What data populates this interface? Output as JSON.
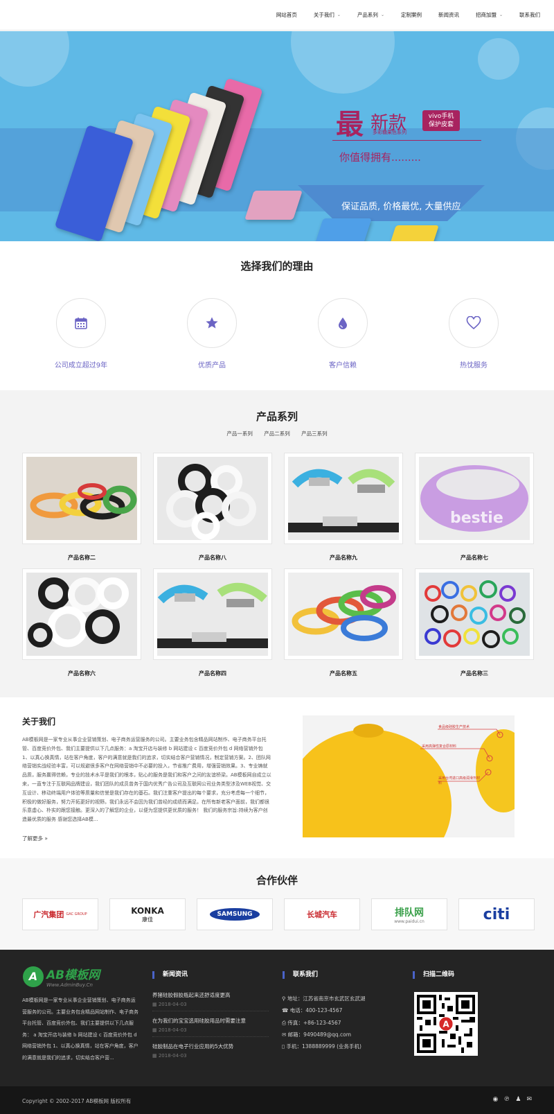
{
  "nav": {
    "items": [
      {
        "label": "网站首页",
        "dropdown": false
      },
      {
        "label": "关于我们",
        "dropdown": true
      },
      {
        "label": "产品系列",
        "dropdown": true
      },
      {
        "label": "定制案例",
        "dropdown": false
      },
      {
        "label": "新闻资讯",
        "dropdown": false
      },
      {
        "label": "招商加盟",
        "dropdown": true
      },
      {
        "label": "联系我们",
        "dropdown": false
      }
    ]
  },
  "banner": {
    "big": "最",
    "new": "新款",
    "tag": "vivo手机 保护皮套",
    "sub": "多彩糖果色系列",
    "want": "你值得拥有.........",
    "guarantee": "保证品质, 价格最优, 大量供应",
    "colors": {
      "sky": "#5fb9e6",
      "magenta": "#a8235f"
    }
  },
  "reasons": {
    "title": "选择我们的理由",
    "items": [
      {
        "label": "公司成立超过9年",
        "icon": "calendar-icon"
      },
      {
        "label": "优质产品",
        "icon": "star-icon"
      },
      {
        "label": "客户信赖",
        "icon": "water-drop-icon"
      },
      {
        "label": "热忱服务",
        "icon": "heart-icon"
      }
    ]
  },
  "products": {
    "title": "产品系列",
    "categories": [
      "产品一系列",
      "产品二系列",
      "产品三系列"
    ],
    "items": [
      {
        "name": "产品名称二"
      },
      {
        "name": "产品名称八"
      },
      {
        "name": "产品名称九"
      },
      {
        "name": "产品名称七"
      },
      {
        "name": "产品名称六"
      },
      {
        "name": "产品名称四"
      },
      {
        "name": "产品名称五"
      },
      {
        "name": "产品名称三"
      }
    ]
  },
  "about": {
    "title": "关于我们",
    "text": "AB模板网是一家专业从事企业营销策划、电子商务运营服务的公司。主要业务包含精品网站制作、电子商务平台托管、百度竞价外包、我们主要提供以下几点服务：a 淘宝开店与装修 b 网站建设 c 百度竞价外包 d 网络营销外包 1、以真心换真情，站在客户角度，客户的满意就是我们的追求，切实结合客户营销情况，制定营销方案。2、团队网络营销实战经验丰富，可以规避很多客户在网络营销中不必要的投入，节省推广费用，增强营销效果。3、专业铸就品质，服务赢得信赖，专业的技术水平是我们的根本，贴心的服务是我们和客户之间的友谊桥梁。AB模板网自成立以来，一直专注于互联网品牌建设，我们团队的成员曾务于国内优秀广告公司及互联网公司业务类型涉及WEB视觉、交互设计、移动终端用户体验等质量和信誉是我们存在的基石。我们注重客户提出的每个要求，充分考虑每一个细节，积极的做好服务，努力开拓更好的视野。我们永远不会因为我们曾经的成绩而满足。在所有新老客户面前，我们都很乐意虚心、朴实的跟您接触。更深入的了解您的企业，以便为您提供更优质的服务！ 我们的服务宗旨:持续为客户创造最优质的服务 感谢您选择AB模...",
    "more": "了解更多 »",
    "callouts": [
      "食品级硅胶生产技术",
      "采用高弹性复合原材料",
      "采用台湾进口高级润滑剂材料"
    ]
  },
  "partners": {
    "title": "合作伙伴",
    "logos": [
      {
        "name": "广汽集团",
        "sub": "GAC GROUP"
      },
      {
        "name": "KONKA",
        "sub": "康佳"
      },
      {
        "name": "SAMSUNG",
        "sub": ""
      },
      {
        "name": "长城汽车",
        "sub": ""
      },
      {
        "name": "排队网",
        "sub": "www.paidui.cn"
      },
      {
        "name": "citi",
        "sub": ""
      }
    ]
  },
  "footer": {
    "logo_brand": "AB模板网",
    "logo_url": "Www.AdminBuy.Cn",
    "desc": "AB模板网是一家专业从事企业营销策划、电子商务运营服务的公司。主要业务包含精品网站制作、电子商务平台托管、百度竞价外包、我们主要提供以下几点服务： a 淘宝开店与装修 b 网站建设 c 百度竞价外包 d 网络营销外包 1、以真心换真情，站在客户角度，客户的满意就是我们的追求，切实结合客户营...",
    "news_title": "新闻资讯",
    "news": [
      {
        "title": "养猪硅胶假胶瓶起来还舒适度更高",
        "date": "2018-04-03"
      },
      {
        "title": "在为我们的宝宝选用硅胶用品时需要注意",
        "date": "2018-04-03"
      },
      {
        "title": "硅胶制品在电子行业应用的5大优势",
        "date": "2018-04-03"
      }
    ],
    "contact_title": "联系我们",
    "contact": [
      {
        "icon": "location-icon",
        "text": "地址：江苏省南京市玄武区玄武湖"
      },
      {
        "icon": "phone-icon",
        "text": "电话：400-123-4567"
      },
      {
        "icon": "fax-icon",
        "text": "传真：+86-123-4567"
      },
      {
        "icon": "mail-icon",
        "text": "邮箱：9490489@qq.com"
      },
      {
        "icon": "mobile-icon",
        "text": "手机：1388889999 (业务手机)"
      }
    ],
    "qr_title": "扫描二维码"
  },
  "copyright": "Copyright © 2002-2017 AB模板网 版权所有"
}
